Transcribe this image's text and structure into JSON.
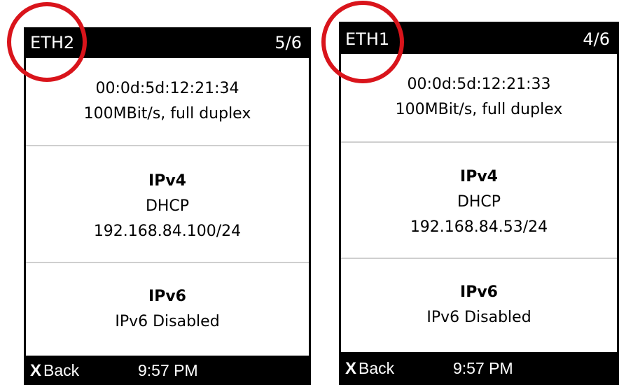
{
  "screens": [
    {
      "interface": "ETH2",
      "page": "5/6",
      "link": {
        "mac": "00:0d:5d:12:21:34",
        "speed": "100MBit/s, full duplex"
      },
      "ipv4": {
        "heading": "IPv4",
        "mode": "DHCP",
        "address": "192.168.84.100/24"
      },
      "ipv6": {
        "heading": "IPv6",
        "status": "IPv6 Disabled"
      },
      "footer": {
        "back_icon": "X",
        "back_label": "Back",
        "time": "9:57 PM"
      }
    },
    {
      "interface": "ETH1",
      "page": "4/6",
      "link": {
        "mac": "00:0d:5d:12:21:33",
        "speed": "100MBit/s, full duplex"
      },
      "ipv4": {
        "heading": "IPv4",
        "mode": "DHCP",
        "address": "192.168.84.53/24"
      },
      "ipv6": {
        "heading": "IPv6",
        "status": "IPv6 Disabled"
      },
      "footer": {
        "back_icon": "X",
        "back_label": "Back",
        "time": "9:57 PM"
      }
    }
  ],
  "colors": {
    "header_bg": "#000000",
    "header_fg": "#ffffff",
    "divider": "#cfcfcf",
    "highlight_circle": "#d9141b"
  }
}
